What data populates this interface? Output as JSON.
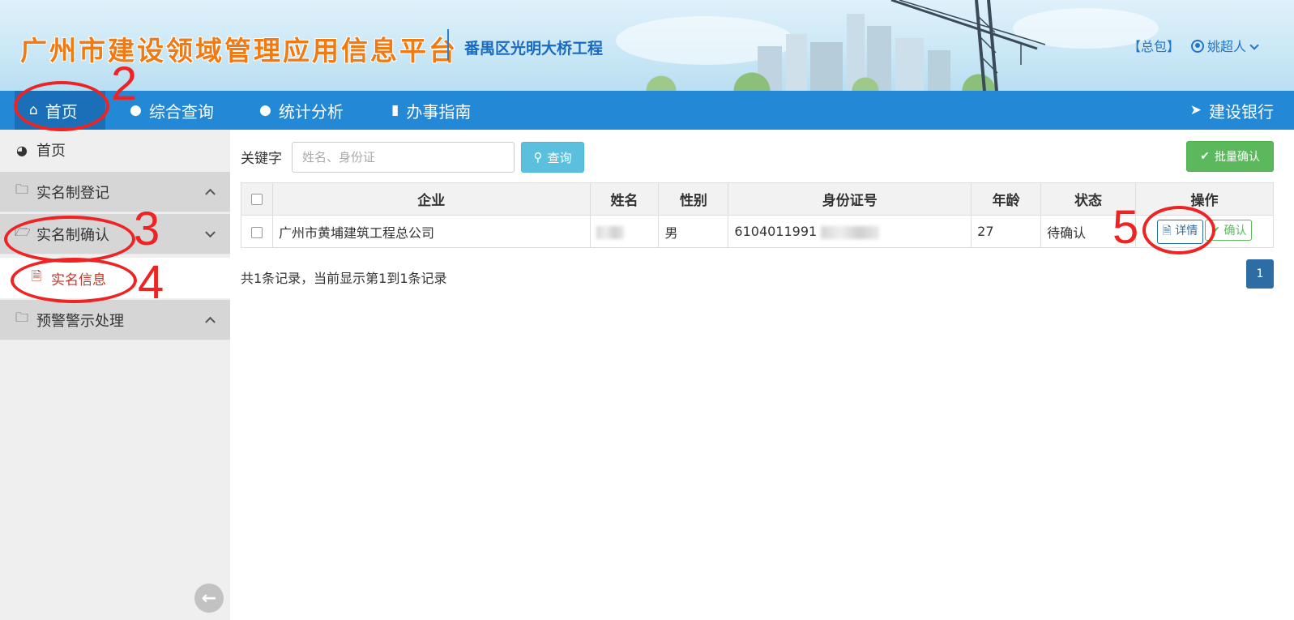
{
  "header": {
    "platform_title": "广州市建设领域管理应用信息平台",
    "project_name": "番禺区光明大桥工程",
    "role": "【总包】",
    "username": "姚超人"
  },
  "nav": {
    "home": "首页",
    "query": "综合查询",
    "stats": "统计分析",
    "guide": "办事指南",
    "bank": "建设银行"
  },
  "sidebar": {
    "home": "首页",
    "registration": "实名制登记",
    "confirmation": "实名制确认",
    "info": "实名信息",
    "warning": "预警警示处理"
  },
  "search": {
    "label": "关键字",
    "placeholder": "姓名、身份证",
    "query_button": "查询",
    "batch_button": "批量确认"
  },
  "table": {
    "headers": [
      "企业",
      "姓名",
      "性别",
      "身份证号",
      "年龄",
      "状态",
      "操作"
    ],
    "rows": [
      {
        "company": "广州市黄埔建筑工程总公司",
        "gender": "男",
        "id_prefix": "6104011991",
        "age": "27",
        "status": "待确认",
        "detail": "详情",
        "confirm": "确认"
      }
    ]
  },
  "pagination": {
    "summary": "共1条记录，当前显示第1到1条记录",
    "current": "1"
  },
  "annotations": [
    "2",
    "3",
    "4",
    "5"
  ]
}
